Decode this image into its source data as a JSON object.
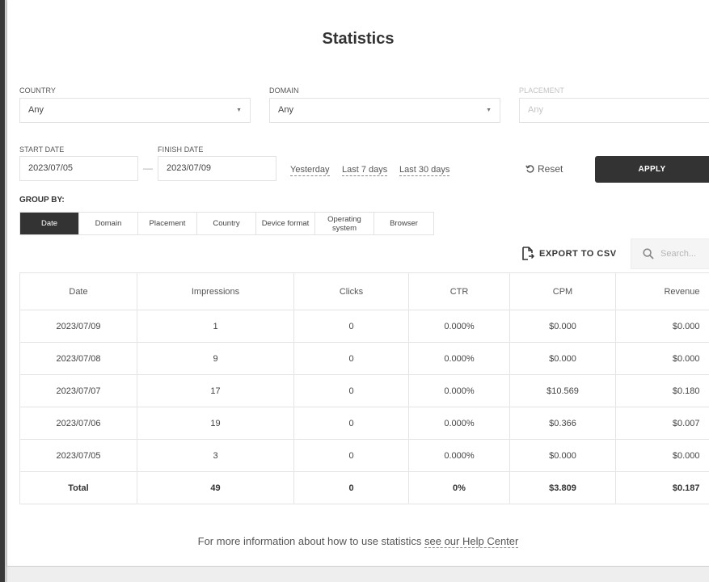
{
  "page": {
    "title": "Statistics"
  },
  "filters": {
    "country": {
      "label": "COUNTRY",
      "value": "Any"
    },
    "domain": {
      "label": "DOMAIN",
      "value": "Any"
    },
    "placement": {
      "label": "PLACEMENT",
      "placeholder": "Any"
    },
    "start_date": {
      "label": "START DATE",
      "value": "2023/07/05"
    },
    "finish_date": {
      "label": "FINISH DATE",
      "value": "2023/07/09"
    },
    "date_separator": "—",
    "quick_ranges": [
      "Yesterday",
      "Last 7 days",
      "Last 30 days"
    ],
    "reset_label": "Reset",
    "apply_label": "APPLY"
  },
  "group_by": {
    "label": "GROUP BY:",
    "options": [
      "Date",
      "Domain",
      "Placement",
      "Country",
      "Device format",
      "Operating system",
      "Browser"
    ],
    "selected": "Date"
  },
  "toolbar": {
    "export_label": "EXPORT TO CSV",
    "search_placeholder": "Search..."
  },
  "table": {
    "columns": [
      "Date",
      "Impressions",
      "Clicks",
      "CTR",
      "CPM",
      "Revenue"
    ],
    "rows": [
      [
        "2023/07/09",
        "1",
        "0",
        "0.000%",
        "$0.000",
        "$0.000"
      ],
      [
        "2023/07/08",
        "9",
        "0",
        "0.000%",
        "$0.000",
        "$0.000"
      ],
      [
        "2023/07/07",
        "17",
        "0",
        "0.000%",
        "$10.569",
        "$0.180"
      ],
      [
        "2023/07/06",
        "19",
        "0",
        "0.000%",
        "$0.366",
        "$0.007"
      ],
      [
        "2023/07/05",
        "3",
        "0",
        "0.000%",
        "$0.000",
        "$0.000"
      ]
    ],
    "total": [
      "Total",
      "49",
      "0",
      "0%",
      "$3.809",
      "$0.187"
    ]
  },
  "footer": {
    "help_text": "For more information about how to use statistics ",
    "help_link": "see our Help Center"
  },
  "icons": {
    "caret": "caret-down-icon",
    "reset": "reset-icon",
    "export": "export-file-icon",
    "search": "search-icon"
  },
  "colors": {
    "primary_dark": "#333333",
    "border": "#e2e2e2",
    "background": "#ffffff"
  }
}
